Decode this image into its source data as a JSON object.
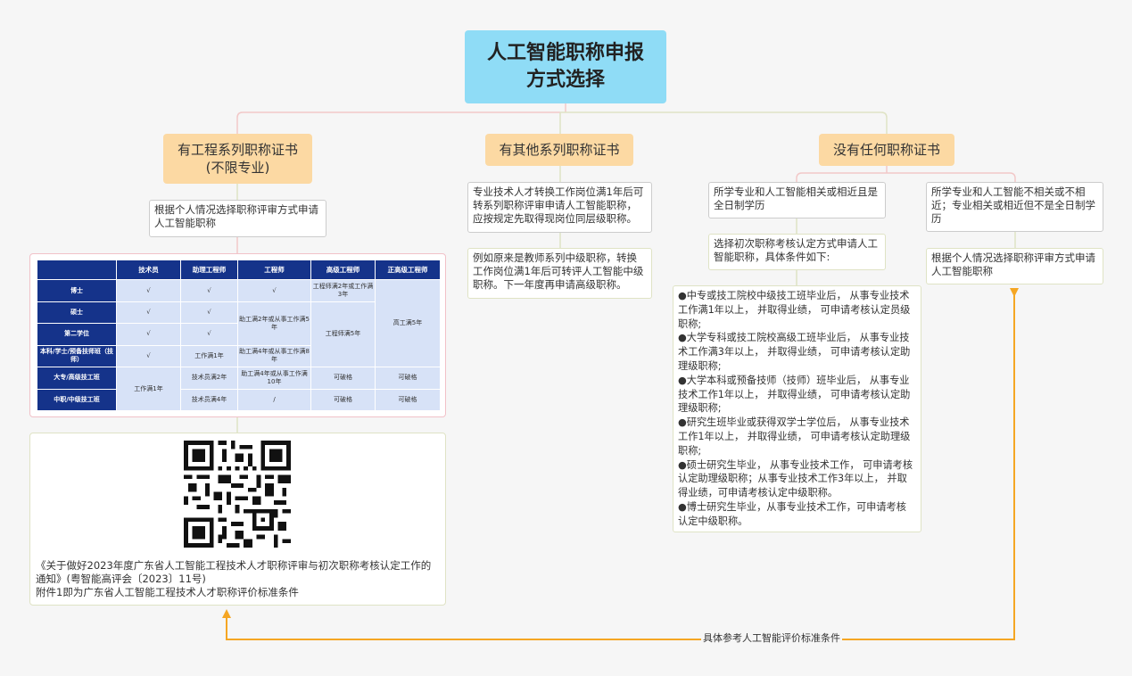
{
  "root": {
    "line1": "人工智能职称申报",
    "line2": "方式选择"
  },
  "branches": {
    "engineering": {
      "line1": "有工程系列职称证书",
      "line2": "(不限专业)"
    },
    "other": {
      "label": "有其他系列职称证书"
    },
    "none": {
      "label": "没有任何职称证书"
    }
  },
  "engineering_note": "根据个人情况选择职称评审方式申请人工智能职称",
  "table": {
    "headers": [
      "",
      "技术员",
      "助理工程师",
      "工程师",
      "高级工程师",
      "正高级工程师"
    ],
    "rows": [
      "博士",
      "硕士",
      "第二学位",
      "本科/学士/预备技师班（技师）",
      "大专/高级技工班",
      "中职/中级技工班"
    ],
    "r1": {
      "tech": "√",
      "assist": "√",
      "eng": "√",
      "senior": "工程师满2年或工作满3年",
      "prof": "高工满5年"
    },
    "r2": {
      "tech": "√",
      "assist": "√",
      "eng": "助工满2年或从事工作满5年",
      "senior": "工程师满5年"
    },
    "r3": {
      "tech": "√",
      "assist": "√"
    },
    "r4": {
      "tech": "√",
      "assist": "工作满1年",
      "eng": "助工满4年或从事工作满8年"
    },
    "r5": {
      "tech": "工作满1年",
      "assist": "技术员满2年",
      "eng": "助工满4年或从事工作满10年",
      "senior": "可破格",
      "prof": "可破格"
    },
    "r6": {
      "assist": "技术员满4年",
      "eng": "/",
      "senior": "可破格",
      "prof": "可破格"
    }
  },
  "reference": {
    "line1": "《关于做好2023年度广东省人工智能工程技术人才职称评审与初次职称考核认定工作的",
    "line2": "通知》(粤智能高评会〔2023〕11号)",
    "line3": "附件1即为广东省人工智能工程技术人才职称评价标准条件"
  },
  "other_notes": {
    "note1": "专业技术人才转换工作岗位满1年后可转系列职称评审申请人工智能职称，应按规定先取得现岗位同层级职称。",
    "note2": "例如原来是教师系列中级职称，转换工作岗位满1年后可转评人工智能中级职称。下一年度再申请高级职称。"
  },
  "none_notes": {
    "related": "所学专业和人工智能相关或相近且是全日制学历",
    "unrelated": "所学专业和人工智能不相关或不相近；专业相关或相近但不是全日制学历",
    "initial": "选择初次职称考核认定方式申请人工智能职称，具体条件如下:",
    "personal": "根据个人情况选择职称评审方式申请人工智能职称",
    "conditions": [
      "●中专或技工院校中级技工班毕业后， 从事专业技术工作满1年以上， 并取得业绩， 可申请考核认定员级职称;",
      "●大学专科或技工院校高级工班毕业后， 从事专业技术工作满3年以上， 并取得业绩， 可申请考核认定助理级职称;",
      "●大学本科或预备技师（技师）班毕业后， 从事专业技术工作1年以上， 并取得业绩， 可申请考核认定助理级职称;",
      "●研究生班毕业或获得双学士学位后， 从事专业技术工作1年以上， 并取得业绩， 可申请考核认定助理级职称;",
      "●硕士研究生毕业， 从事专业技术工作， 可申请考核认定助理级职称；从事专业技术工作3年以上， 并取得业绩，可申请考核认定中级职称。",
      "●博士研究生毕业，从事专业技术工作，可申请考核认定中级职称。"
    ]
  },
  "arrow_label": "具体参考人工智能评价标准条件",
  "colors": {
    "root": "#8fdcf6",
    "branch": "#fcd9a3",
    "arrow": "#f5a623",
    "table_header": "#15338a",
    "table_cell": "#d7e2f7"
  }
}
